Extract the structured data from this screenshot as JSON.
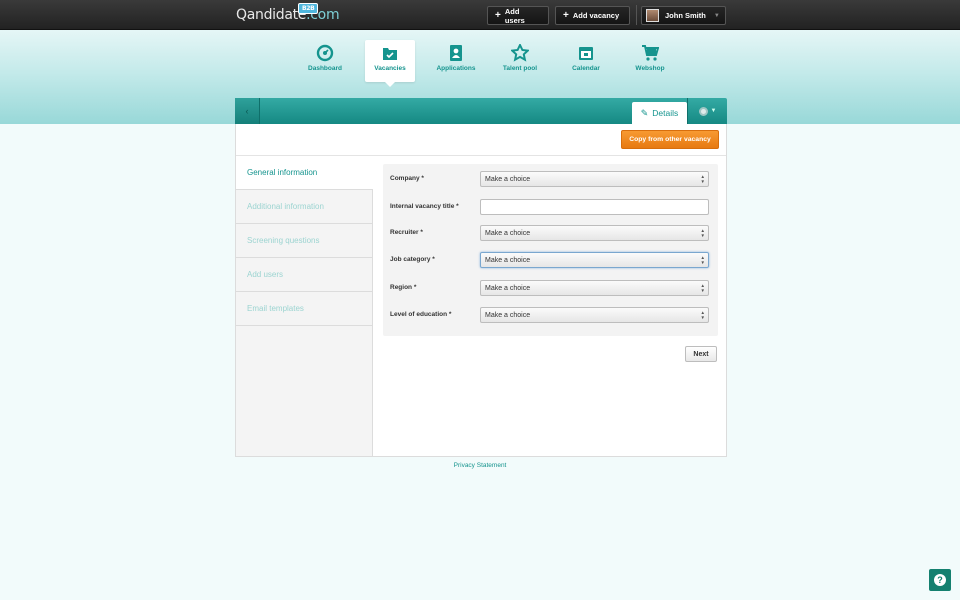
{
  "brand": {
    "name": "Qandidate",
    "suffix": ".com",
    "badge": "B2B"
  },
  "topbar": {
    "add_users": "Add users",
    "add_vacancy": "Add vacancy",
    "user_name": "John Smith"
  },
  "nav": {
    "items": [
      {
        "label": "Dashboard",
        "icon": "dashboard-icon"
      },
      {
        "label": "Vacancies",
        "icon": "vacancies-icon",
        "active": true
      },
      {
        "label": "Applications",
        "icon": "applications-icon"
      },
      {
        "label": "Talent pool",
        "icon": "talent-pool-icon"
      },
      {
        "label": "Calendar",
        "icon": "calendar-icon"
      },
      {
        "label": "Webshop",
        "icon": "webshop-icon"
      }
    ]
  },
  "panel": {
    "back_symbol": "‹",
    "details_tab": "Details",
    "copy_button": "Copy from other vacancy"
  },
  "subnav": {
    "items": [
      {
        "label": "General information",
        "active": true
      },
      {
        "label": "Additional information"
      },
      {
        "label": "Screening questions"
      },
      {
        "label": "Add users"
      },
      {
        "label": "Email templates"
      }
    ]
  },
  "form": {
    "fields": [
      {
        "label": "Company *",
        "type": "select",
        "value": "Make a choice"
      },
      {
        "label": "Internal vacancy title *",
        "type": "text",
        "value": ""
      },
      {
        "label": "Recruiter *",
        "type": "select",
        "value": "Make a choice"
      },
      {
        "label": "Job category *",
        "type": "select",
        "value": "Make a choice",
        "focused": true
      },
      {
        "label": "Region *",
        "type": "select",
        "value": "Make a choice"
      },
      {
        "label": "Level of education *",
        "type": "select",
        "value": "Make a choice"
      }
    ],
    "next_button": "Next"
  },
  "footer": {
    "privacy": "Privacy Statement",
    "help": "?"
  },
  "colors": {
    "teal": "#15948e",
    "orange": "#f08520",
    "topbar": "#2b2b2b"
  }
}
